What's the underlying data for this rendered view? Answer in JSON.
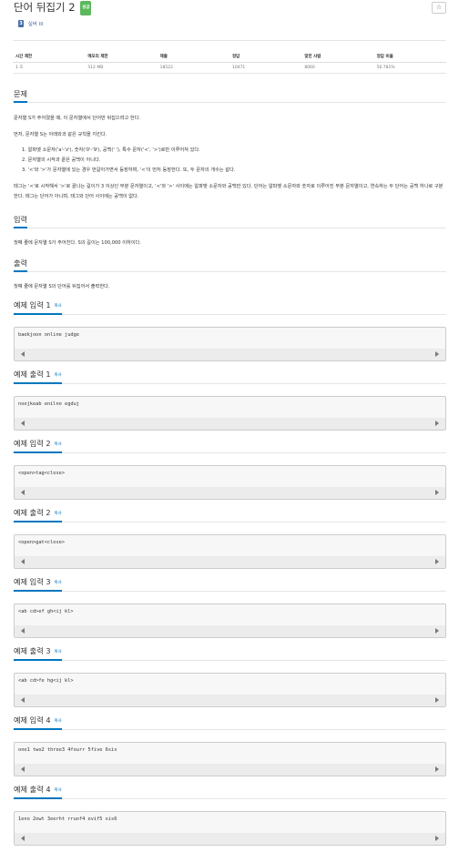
{
  "problem": {
    "title": "단어 뒤집기 2",
    "lang_badge": "성공",
    "star": "☆",
    "tier_icon": "3",
    "tier_label": "실버 III"
  },
  "info_table": {
    "headers": [
      "시간 제한",
      "메모리 제한",
      "제출",
      "정답",
      "맞힌 사람",
      "정답 비율"
    ],
    "values": [
      "1 초",
      "512 MB",
      "18522",
      "10471",
      "8060",
      "56.781%"
    ]
  },
  "sections": {
    "problem_title": "문제",
    "problem_paras": [
      "문자열 S가 주어졌을 때, 이 문자열에서 단어만 뒤집으려고 한다.",
      "먼저, 문자열 S는 아래와과 같은 규칙을 지킨다."
    ],
    "rules": [
      "1. 알파벳 소문자('a'-'z'), 숫자('0'-'9'), 공백(' '), 특수 문자('<', '>')로만 이루어져 있다.",
      "2. 문자열의 시작과 끝은 공백이 아니다.",
      "3. '<'와 '>'가 문자열에 있는 경우 번갈아가면서 등장하며, '<'이 먼저 등장한다. 또, 두 문자의 개수는 같다."
    ],
    "tag_para": "태그는 '<'로 시작해서 '>'로 끝나는 길이가 3 이상인 부분 문자열이고, '<'와 '>' 사이에는 알파벳 소문자와 공백만 있다. 단어는 알파벳 소문자와 숫자로 이루어진 부분 문자열이고, 연속하는 두 단어는 공백 하나로 구분한다. 태그는 단어가 아니며, 태그와 단어 사이에는 공백이 없다.",
    "input_title": "입력",
    "input_para": "첫째 줄에 문자열 S가 주어진다. S의 길이는 100,000 이하이다.",
    "output_title": "출력",
    "output_para": "첫째 줄에 문자열 S의 단어를 뒤집어서 출력한다."
  },
  "copy_label": "복사",
  "samples": [
    {
      "title": "예제 입력 1",
      "text": "baekjoon online judge"
    },
    {
      "title": "예제 출력 1",
      "text": "noojkeab enilno egduj"
    },
    {
      "title": "예제 입력 2",
      "text": "<open>tag<close>"
    },
    {
      "title": "예제 출력 2",
      "text": "<open>gat<close>"
    },
    {
      "title": "예제 입력 3",
      "text": "<ab cd>ef gh<ij kl>"
    },
    {
      "title": "예제 출력 3",
      "text": "<ab cd>fe hg<ij kl>"
    },
    {
      "title": "예제 입력 4",
      "text": "one1 two2 three3 4fourr 5five 6six"
    },
    {
      "title": "예제 출력 4",
      "text": "1eno 2owt 3eerht rruof4 evif5 xis6"
    }
  ]
}
